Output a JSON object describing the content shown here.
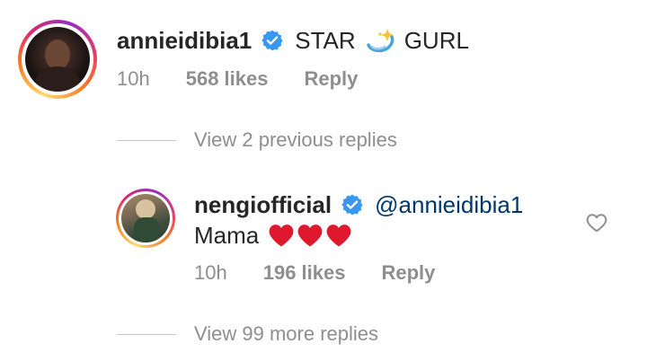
{
  "comment": {
    "username": "annieidibia1",
    "text_part1": "STAR",
    "text_part2": "GURL",
    "emoji": "dizzy-sparkle",
    "time": "10h",
    "likes": "568 likes",
    "reply": "Reply"
  },
  "view_previous": "View 2 previous replies",
  "reply_comment": {
    "username": "nengiofficial",
    "mention": "@annieidibia1",
    "text": "Mama",
    "hearts": 3,
    "time": "10h",
    "likes": "196 likes",
    "reply": "Reply"
  },
  "view_more": "View 99 more replies",
  "colors": {
    "verified": "#3897f0",
    "heart": "#e0182d",
    "mention": "#00376b",
    "meta": "#8e8e8e"
  }
}
